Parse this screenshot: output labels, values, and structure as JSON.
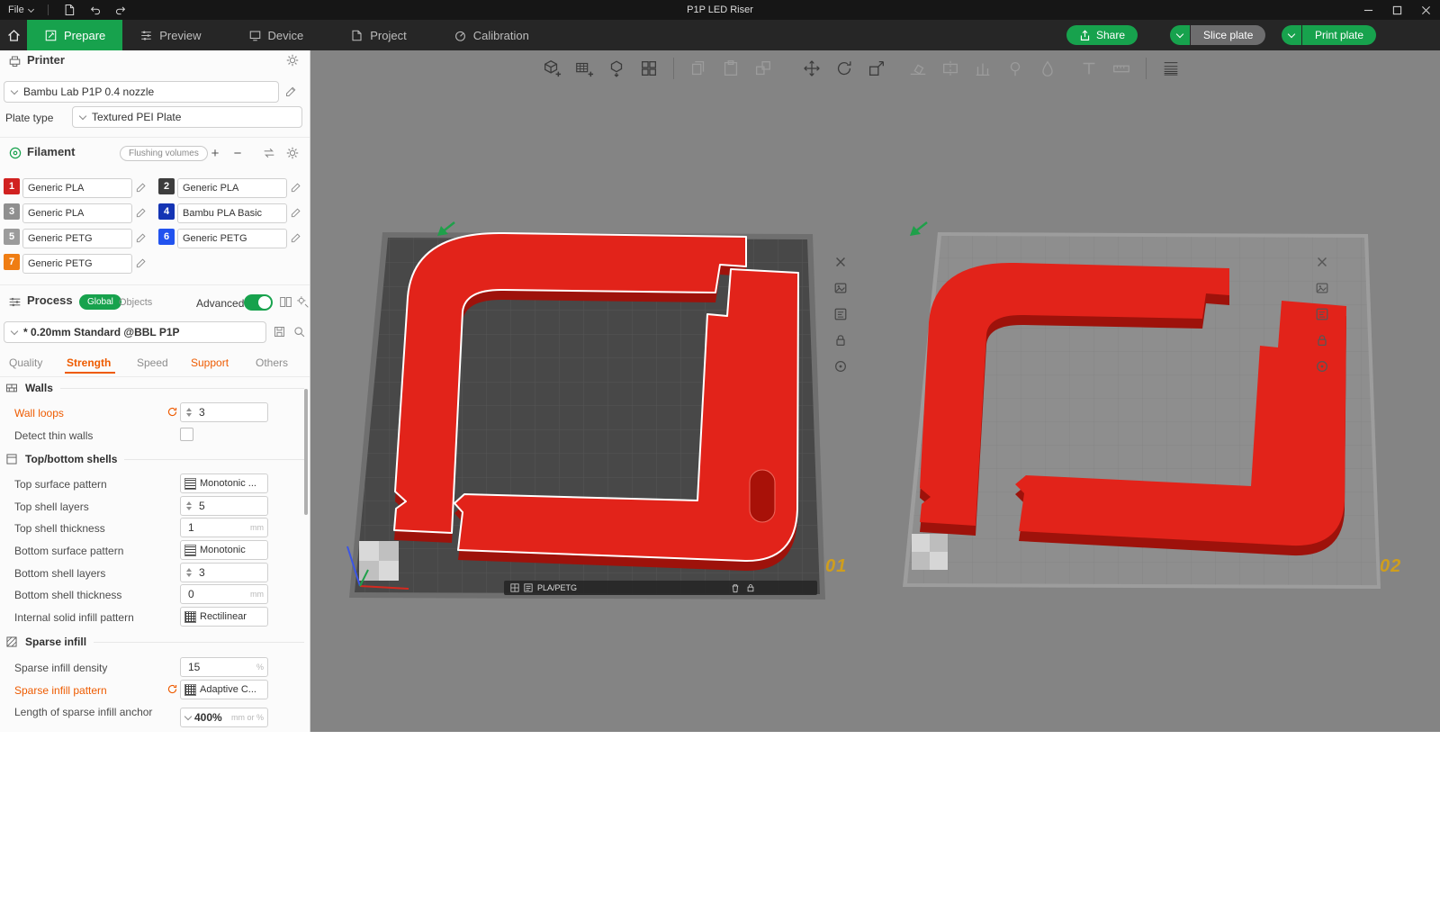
{
  "colors": {
    "accent_green": "#17a24d",
    "modified_orange": "#ee5b00",
    "object_red": "#e2231a",
    "object_red_dark": "#9e120b",
    "plate_label_gold": "#cf9e1d",
    "slice_gray": "#6d6d6e"
  },
  "titlebar": {
    "menu_file": "File",
    "title": "P1P LED Riser"
  },
  "nav": {
    "tabs": [
      {
        "label": "Prepare"
      },
      {
        "label": "Preview"
      },
      {
        "label": "Device"
      },
      {
        "label": "Project"
      },
      {
        "label": "Calibration"
      }
    ],
    "share": "Share",
    "slice_plate": "Slice plate",
    "print_plate": "Print plate"
  },
  "printer": {
    "title": "Printer",
    "preset": "Bambu Lab P1P 0.4 nozzle",
    "plate_type_label": "Plate type",
    "plate_type": "Textured PEI Plate"
  },
  "filament": {
    "title": "Filament",
    "flushing_volumes": "Flushing volumes",
    "items": [
      {
        "num": "1",
        "name": "Generic PLA",
        "color": "#d12120"
      },
      {
        "num": "2",
        "name": "Generic PLA",
        "color": "#3d3d3d"
      },
      {
        "num": "3",
        "name": "Generic PLA",
        "color": "#8f8f8f"
      },
      {
        "num": "4",
        "name": "Bambu PLA Basic",
        "color": "#1434b4"
      },
      {
        "num": "5",
        "name": "Generic PETG",
        "color": "#9b9b9b"
      },
      {
        "num": "6",
        "name": "Generic PETG",
        "color": "#2253ef"
      },
      {
        "num": "7",
        "name": "Generic PETG",
        "color": "#ef7d13"
      }
    ]
  },
  "process": {
    "title": "Process",
    "scope_global": "Global",
    "scope_objects": "Objects",
    "advanced": "Advanced",
    "preset": "* 0.20mm Standard @BBL P1P",
    "tabs": [
      {
        "label": "Quality"
      },
      {
        "label": "Strength"
      },
      {
        "label": "Speed"
      },
      {
        "label": "Support"
      },
      {
        "label": "Others"
      }
    ]
  },
  "settings": {
    "groups": [
      {
        "title": "Walls"
      },
      {
        "title": "Top/bottom shells"
      },
      {
        "title": "Sparse infill"
      }
    ],
    "rows": {
      "wall_loops": {
        "label": "Wall loops",
        "value": "3"
      },
      "detect_thin_walls": {
        "label": "Detect thin walls"
      },
      "top_surface_pattern": {
        "label": "Top surface pattern",
        "value": "Monotonic ..."
      },
      "top_shell_layers": {
        "label": "Top shell layers",
        "value": "5"
      },
      "top_shell_thickness": {
        "label": "Top shell thickness",
        "value": "1",
        "unit": "mm"
      },
      "bottom_surface_pattern": {
        "label": "Bottom surface pattern",
        "value": "Monotonic"
      },
      "bottom_shell_layers": {
        "label": "Bottom shell layers",
        "value": "3"
      },
      "bottom_shell_thickness": {
        "label": "Bottom shell thickness",
        "value": "0",
        "unit": "mm"
      },
      "internal_solid_infill_pattern": {
        "label": "Internal solid infill pattern",
        "value": "Rectilinear"
      },
      "sparse_infill_density": {
        "label": "Sparse infill density",
        "value": "15",
        "unit": "%"
      },
      "sparse_infill_pattern": {
        "label": "Sparse infill pattern",
        "value": "Adaptive C..."
      },
      "sparse_anchor": {
        "label": "Length of sparse infill anchor",
        "value": "400%",
        "unit": "mm or %"
      }
    }
  },
  "viewport": {
    "plate1": {
      "label": "01",
      "tag": "PLA/PETG"
    },
    "plate2": {
      "label": "02"
    }
  },
  "icons": {
    "add-icon": "+",
    "remove-icon": "−",
    "search-icon": "magnifier",
    "gear-icon": "gear",
    "edit-icon": "pencil",
    "close-icon": "x",
    "minimize-icon": "-",
    "maximize-icon": "square",
    "undo-icon": "arrow-left-curve",
    "redo-icon": "arrow-right-curve",
    "home-icon": "house",
    "lock-icon": "padlock",
    "delete-plate-icon": "x"
  }
}
